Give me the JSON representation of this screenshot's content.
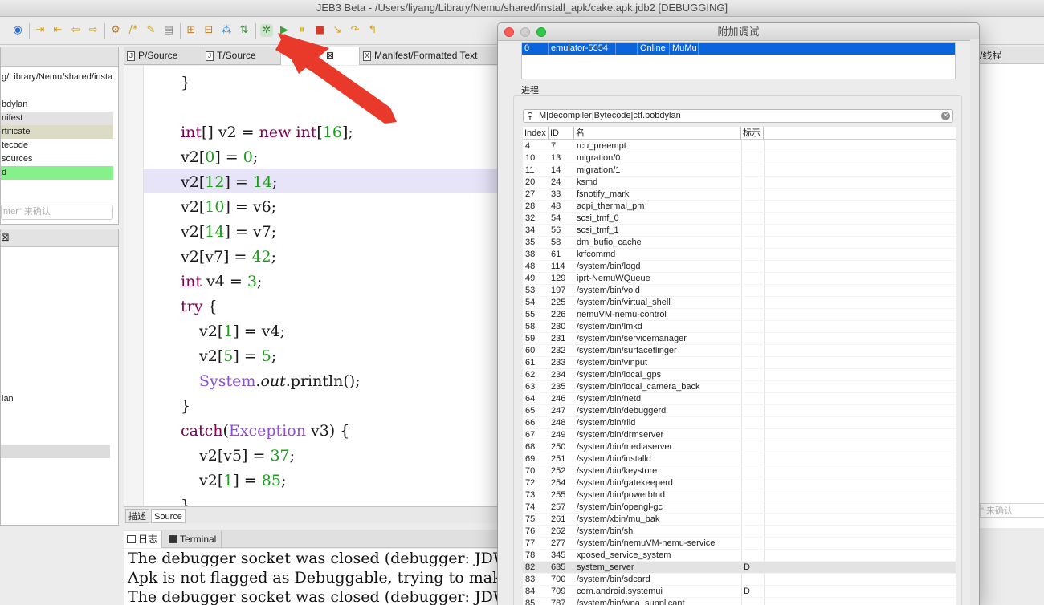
{
  "window": {
    "title": "JEB3 Beta - /Users/liyang/Library/Nemu/shared/install_apk/cake.apk.jdb2 [DEBUGGING]"
  },
  "left_panel": {
    "path": "g/Library/Nemu/shared/insta",
    "items": [
      "bdylan",
      "nifest",
      "rtificate",
      "tecode",
      "sources",
      "d"
    ],
    "filter_placeholder": "nter\" 来确认",
    "tree_item": "lan"
  },
  "editor": {
    "tabs": [
      "P/Source",
      "T/Source",
      "ource",
      "Manifest/Formatted Text"
    ],
    "bottom_tabs": [
      "描述",
      "Source"
    ]
  },
  "console": {
    "tabs": [
      "日志",
      "Terminal"
    ],
    "lines": [
      "The debugger socket was closed (debugger: JDWP",
      "Apk is not flagged as Debuggable, trying to make",
      "The debugger socket was closed (debugger: JDWP"
    ]
  },
  "right_panel": {
    "header": "/线程",
    "filter_placeholder": "\" 来确认"
  },
  "dialog": {
    "title": "附加调试",
    "device": {
      "index": "0",
      "name": "emulator-5554",
      "status": "Online",
      "info": "MuMu"
    },
    "process_label": "进程",
    "search": "M|decompiler|Bytecode|ctf.bobdylan",
    "columns": [
      "Index",
      "ID",
      "名",
      "标示"
    ],
    "processes": [
      {
        "index": "4",
        "id": "7",
        "name": "rcu_preempt",
        "flag": ""
      },
      {
        "index": "10",
        "id": "13",
        "name": "migration/0",
        "flag": ""
      },
      {
        "index": "11",
        "id": "14",
        "name": "migration/1",
        "flag": ""
      },
      {
        "index": "20",
        "id": "24",
        "name": "ksmd",
        "flag": ""
      },
      {
        "index": "27",
        "id": "33",
        "name": "fsnotify_mark",
        "flag": ""
      },
      {
        "index": "28",
        "id": "48",
        "name": "acpi_thermal_pm",
        "flag": ""
      },
      {
        "index": "32",
        "id": "54",
        "name": "scsi_tmf_0",
        "flag": ""
      },
      {
        "index": "34",
        "id": "56",
        "name": "scsi_tmf_1",
        "flag": ""
      },
      {
        "index": "35",
        "id": "58",
        "name": "dm_bufio_cache",
        "flag": ""
      },
      {
        "index": "38",
        "id": "61",
        "name": "krfcommd",
        "flag": ""
      },
      {
        "index": "48",
        "id": "114",
        "name": "/system/bin/logd",
        "flag": ""
      },
      {
        "index": "49",
        "id": "129",
        "name": "iprt-NemuWQueue",
        "flag": ""
      },
      {
        "index": "53",
        "id": "197",
        "name": "/system/bin/vold",
        "flag": ""
      },
      {
        "index": "54",
        "id": "225",
        "name": "/system/bin/virtual_shell",
        "flag": ""
      },
      {
        "index": "55",
        "id": "226",
        "name": "nemuVM-nemu-control",
        "flag": ""
      },
      {
        "index": "58",
        "id": "230",
        "name": "/system/bin/lmkd",
        "flag": ""
      },
      {
        "index": "59",
        "id": "231",
        "name": "/system/bin/servicemanager",
        "flag": ""
      },
      {
        "index": "60",
        "id": "232",
        "name": "/system/bin/surfaceflinger",
        "flag": ""
      },
      {
        "index": "61",
        "id": "233",
        "name": "/system/bin/vinput",
        "flag": ""
      },
      {
        "index": "62",
        "id": "234",
        "name": "/system/bin/local_gps",
        "flag": ""
      },
      {
        "index": "63",
        "id": "235",
        "name": "/system/bin/local_camera_back",
        "flag": ""
      },
      {
        "index": "64",
        "id": "246",
        "name": "/system/bin/netd",
        "flag": ""
      },
      {
        "index": "65",
        "id": "247",
        "name": "/system/bin/debuggerd",
        "flag": ""
      },
      {
        "index": "66",
        "id": "248",
        "name": "/system/bin/rild",
        "flag": ""
      },
      {
        "index": "67",
        "id": "249",
        "name": "/system/bin/drmserver",
        "flag": ""
      },
      {
        "index": "68",
        "id": "250",
        "name": "/system/bin/mediaserver",
        "flag": ""
      },
      {
        "index": "69",
        "id": "251",
        "name": "/system/bin/installd",
        "flag": ""
      },
      {
        "index": "70",
        "id": "252",
        "name": "/system/bin/keystore",
        "flag": ""
      },
      {
        "index": "72",
        "id": "254",
        "name": "/system/bin/gatekeeperd",
        "flag": ""
      },
      {
        "index": "73",
        "id": "255",
        "name": "/system/bin/powerbtnd",
        "flag": ""
      },
      {
        "index": "74",
        "id": "257",
        "name": "/system/bin/opengl-gc",
        "flag": ""
      },
      {
        "index": "75",
        "id": "261",
        "name": "/system/xbin/mu_bak",
        "flag": ""
      },
      {
        "index": "76",
        "id": "262",
        "name": "/system/bin/sh",
        "flag": ""
      },
      {
        "index": "77",
        "id": "277",
        "name": "/system/bin/nemuVM-nemu-service",
        "flag": ""
      },
      {
        "index": "78",
        "id": "345",
        "name": "xposed_service_system",
        "flag": ""
      },
      {
        "index": "82",
        "id": "635",
        "name": "system_server",
        "flag": "D"
      },
      {
        "index": "83",
        "id": "700",
        "name": "/system/bin/sdcard",
        "flag": ""
      },
      {
        "index": "84",
        "id": "709",
        "name": "com.android.systemui",
        "flag": "D"
      },
      {
        "index": "85",
        "id": "787",
        "name": "/system/bin/wpa_supplicant",
        "flag": ""
      }
    ],
    "selected_process": "system_server"
  },
  "colors": {
    "accent": "#0a64dc",
    "annotation_arrow": "#e8392a",
    "keyword": "#7f0055",
    "number": "#19a019",
    "class": "#8d4fd1"
  }
}
